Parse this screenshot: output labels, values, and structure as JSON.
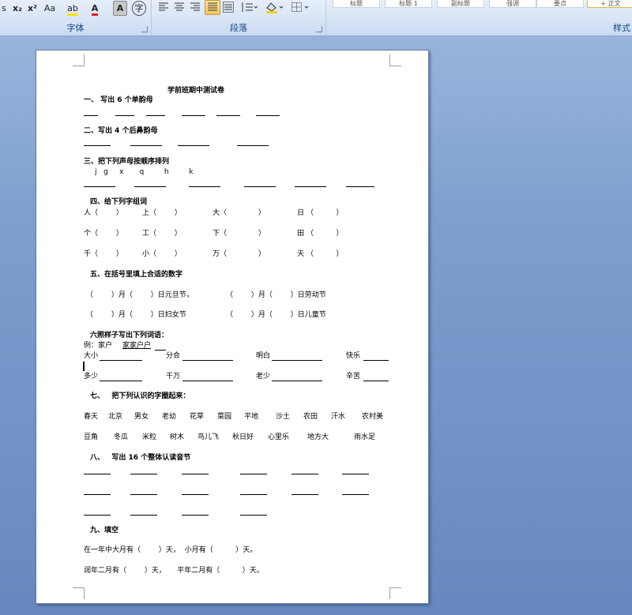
{
  "ribbon": {
    "font_group": {
      "label": "字体",
      "buttons": [
        "s",
        "x₂",
        "x²",
        "Aa",
        "ab",
        "A",
        "A",
        "字"
      ]
    },
    "paragraph_group": {
      "label": "段落"
    },
    "styles_group": {
      "label": "样式",
      "styles": [
        "标题",
        "标题 1",
        "副标题",
        "强调",
        "要点",
        "+ 正文"
      ]
    },
    "colors": {
      "accent": "#15428b",
      "highlight": "#f7c65c",
      "font_color": "#e02020"
    }
  },
  "doc": {
    "title": "学前班期中测试卷",
    "s1": {
      "heading": "一、    写出 6 个单韵母"
    },
    "s2": {
      "heading": "二、写出 4 个后鼻韵母"
    },
    "s3": {
      "heading": "三、把下列声母按顺序排列",
      "letters": "j   g     x       q         h         k"
    },
    "s4": {
      "heading": "四、给下列字组词",
      "rows": [
        [
          "人（        ）",
          "上（        ）",
          "大（              ）",
          "日 （          ）"
        ],
        [
          "个（        ）",
          "工（        ）",
          "下（              ）",
          "田 （          ）"
        ],
        [
          "千（        ）",
          "小（        ）",
          "万（              ）",
          "天 （          ）"
        ]
      ]
    },
    "s5": {
      "heading": "五、在括号里填上合适的数字",
      "rows": [
        [
          "（        ）月（        ）日元旦节，",
          "（        ）月（        ）日劳动节"
        ],
        [
          "（        ）月（        ）日妇女节",
          "（        ）月（        ）日儿童节"
        ]
      ]
    },
    "s6": {
      "heading": "六照样子写出下列词语：",
      "example_prefix": "例：家户",
      "example_answer": "家家户户",
      "words_row1": [
        "大小",
        "分合",
        "明白",
        "快乐"
      ],
      "words_row2": [
        "多少",
        "千万",
        "老少",
        "辛苦"
      ]
    },
    "s7": {
      "heading": "七、   把下列认识的字圈起来：",
      "row1": [
        "春天",
        "北京",
        "男女",
        "老幼",
        "花草",
        "菜园",
        "平地",
        "沙土",
        "农田",
        "汗水",
        "农村美"
      ],
      "row2": [
        "豆角",
        "冬瓜",
        "米粒",
        "树木",
        "鸟儿飞",
        "秋日好",
        "心里乐",
        "地方大",
        "雨水足"
      ]
    },
    "s8": {
      "heading": "八、   写出 16 个整体认读音节"
    },
    "s9": {
      "heading": "九、填空",
      "line1": "在一年中大月有（        ）天，  小月有（          ）天。",
      "line2": "润年二月有（        ）天，     平年二月有（          ）天。"
    }
  }
}
